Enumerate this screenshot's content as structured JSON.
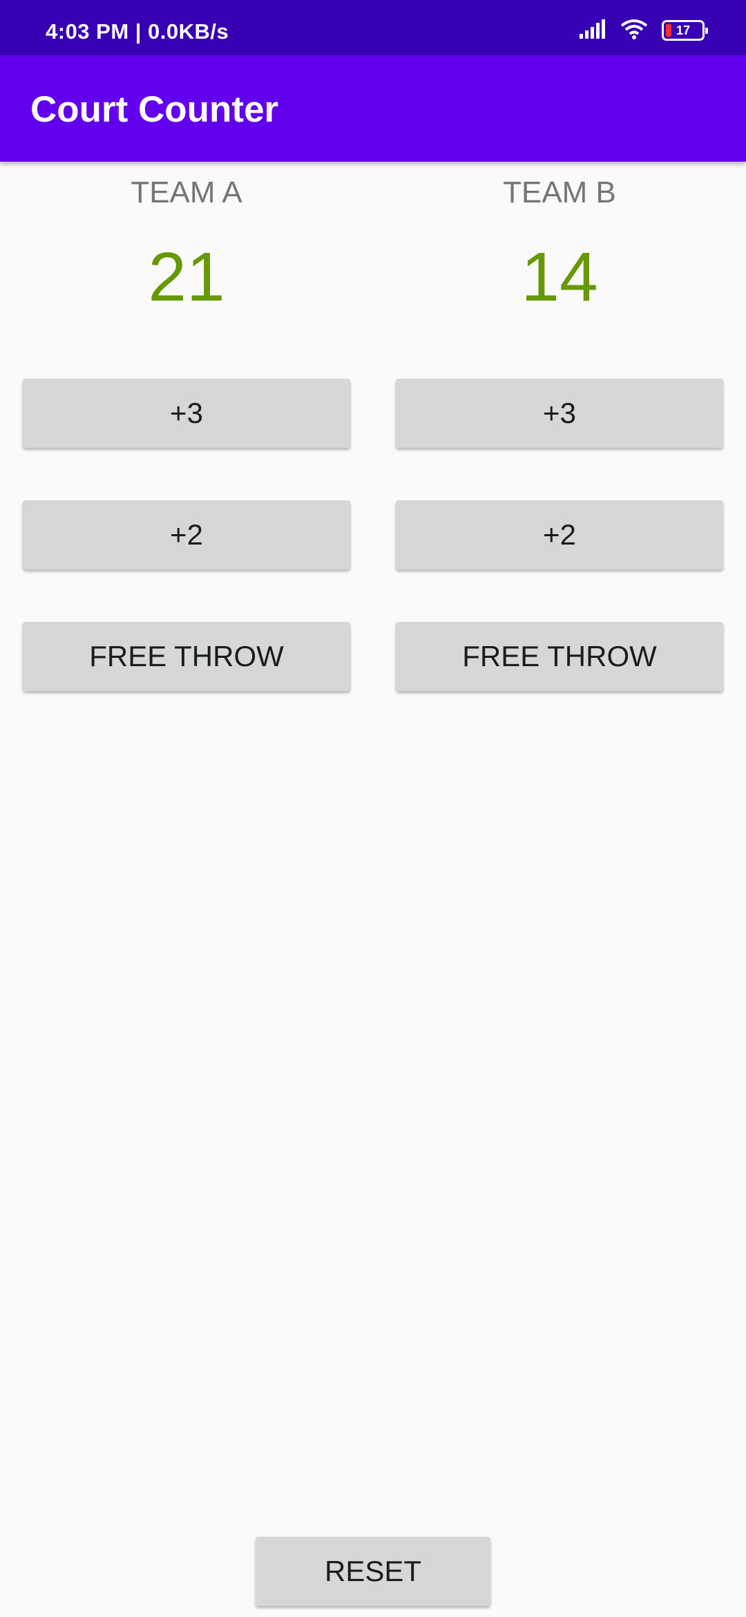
{
  "status_bar": {
    "time_speed": "4:03 PM | 0.0KB/s",
    "battery_level": "17",
    "icons": [
      "signal-icon",
      "wifi-icon",
      "battery-icon"
    ]
  },
  "app_bar": {
    "title": "Court Counter"
  },
  "team_a": {
    "name": "TEAM A",
    "score": "21",
    "buttons": {
      "plus3": "+3",
      "plus2": "+2",
      "free_throw": "FREE THROW"
    }
  },
  "team_b": {
    "name": "TEAM B",
    "score": "14",
    "buttons": {
      "plus3": "+3",
      "plus2": "+2",
      "free_throw": "FREE THROW"
    }
  },
  "reset_label": "RESET",
  "colors": {
    "status_bar": "#3700b3",
    "app_bar": "#6200ee",
    "score": "#669900",
    "team_name": "#757575",
    "button": "#d6d7d7",
    "background": "#fafafa"
  }
}
